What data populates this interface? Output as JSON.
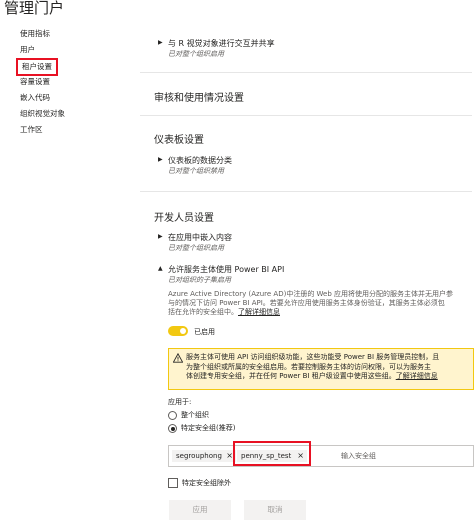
{
  "page_title": "管理门户",
  "sidebar": {
    "items": [
      {
        "label": "使用指标"
      },
      {
        "label": "用户"
      },
      {
        "label": "租户设置"
      },
      {
        "label": "容量设置"
      },
      {
        "label": "嵌入代码"
      },
      {
        "label": "组织视觉对象"
      },
      {
        "label": "工作区"
      }
    ],
    "active_index": 2
  },
  "settings_top": {
    "name": "与 R 视觉对象进行交互并共享",
    "status": "已对整个组织启用"
  },
  "audit_section": {
    "title": "审核和使用情况设置"
  },
  "dashboard_section": {
    "title": "仪表板设置",
    "setting": {
      "name": "仪表板的数据分类",
      "status": "已对整个组织禁用"
    }
  },
  "developer_section": {
    "title": "开发人员设置",
    "embed_setting": {
      "name": "在应用中嵌入内容",
      "status": "已对整个组织启用"
    },
    "sp_setting": {
      "name": "允许服务主体使用 Power BI API",
      "status": "已对组织的子集启用",
      "description_lines": [
        "Azure Active Directory (Azure AD)中注册的 Web 应用将使用分配的服务主体并无用户参",
        "与的情况下访问 Power BI API。若要允许应用使用服务主体身份验证，其服务主体必须包",
        "括在允许的安全组中。"
      ],
      "learn_more": "了解详细信息",
      "toggle_label": "已启用",
      "toggle_on": true,
      "warning_lines": [
        "服务主体可使用 API 访问组织级功能，这些功能受 Power BI 服务管理员控制，且",
        "为整个组织或所属的安全组启用。若要控制服务主体的访问权限，可以为服务主",
        "体创建专用安全组，并在任何 Power BI 租户级设置中使用这些组。"
      ],
      "warning_link": "了解详细信息",
      "apply_to_label": "应用于:",
      "apply_options": [
        {
          "label": "整个组织",
          "checked": false
        },
        {
          "label": "特定安全组(推荐)",
          "checked": true
        }
      ],
      "groups": [
        "segrouphong",
        "penny_sp_test"
      ],
      "group_input_placeholder": "输入安全组",
      "exclude_label": "特定安全组除外",
      "exclude_checked": false
    }
  },
  "buttons": {
    "apply": "应用",
    "cancel": "取消"
  },
  "colors": {
    "toggle": "#f2c811",
    "highlight_border": "#e81123",
    "warning_bg": "#fff4ce"
  }
}
